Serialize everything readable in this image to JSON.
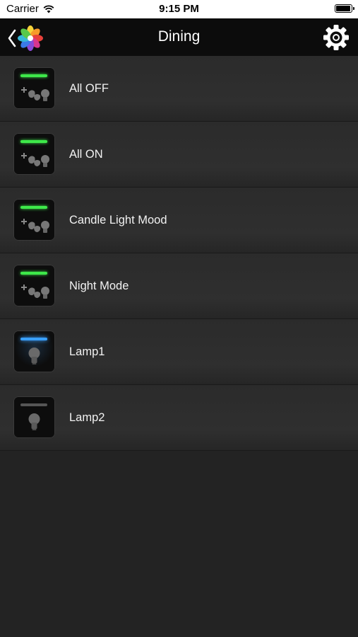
{
  "status_bar": {
    "carrier": "Carrier",
    "time": "9:15 PM"
  },
  "nav": {
    "title": "Dining",
    "back_icon": "chevron-left-icon",
    "logo_icon": "flower-logo-icon",
    "settings_icon": "gear-icon"
  },
  "scenes": [
    {
      "label": "All OFF",
      "icon": "scene-icon",
      "indicator_color": "#3ee84a"
    },
    {
      "label": "All ON",
      "icon": "scene-icon",
      "indicator_color": "#3ee84a"
    },
    {
      "label": "Candle Light Mood",
      "icon": "scene-icon",
      "indicator_color": "#3ee84a"
    },
    {
      "label": "Night Mode",
      "icon": "scene-icon",
      "indicator_color": "#3ee84a"
    },
    {
      "label": "Lamp1",
      "icon": "bulb-icon",
      "indicator_color": "#3aa0ff"
    },
    {
      "label": "Lamp2",
      "icon": "bulb-icon",
      "indicator_color": "#555555"
    }
  ],
  "colors": {
    "background": "#232323",
    "nav_background": "#0c0c0c",
    "text": "#f2f2f2"
  }
}
